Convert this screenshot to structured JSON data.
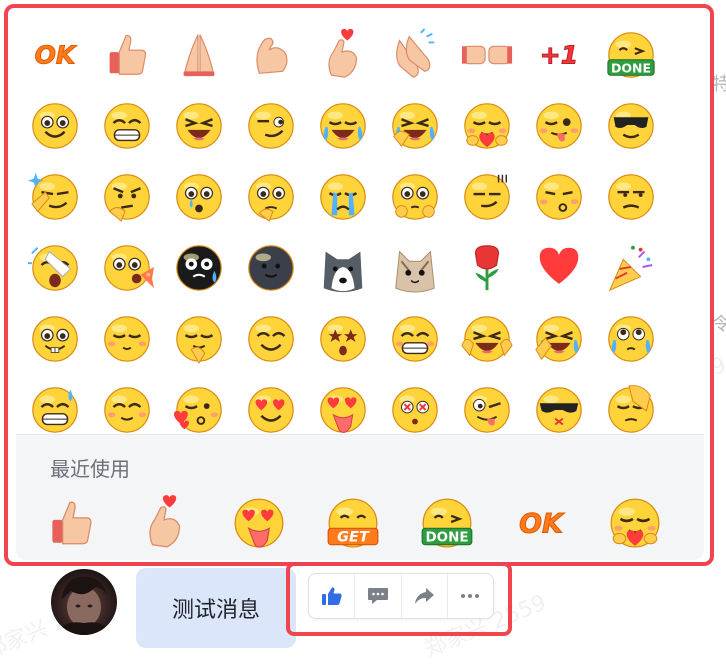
{
  "watermark": "郑家兴 2559",
  "edge_chars": [
    "特",
    "令"
  ],
  "emoji_panel": {
    "grid": [
      "ok-text",
      "thumbs-up",
      "praying-hands",
      "flexed-biceps",
      "finger-heart",
      "clapping-hands",
      "fist-bump",
      "plus-one",
      "done-face",
      "smile",
      "grin",
      "laugh",
      "smirk",
      "tears-of-joy",
      "rolling-laugh",
      "heart-hug",
      "tongue-wink",
      "sunglasses",
      "salute-smirk",
      "thinking",
      "tearful-shock",
      "thinking-eyes",
      "crying",
      "pleading",
      "cool-smirk",
      "kiss-blush",
      "unamused",
      "screaming-slipper",
      "spitting",
      "black-blob-shock",
      "dark-blob",
      "husky",
      "cat-face",
      "rose",
      "red-heart",
      "party-popper",
      "sponge-face",
      "blush",
      "giggle",
      "content-smile",
      "starstruck",
      "wide-grin",
      "laughing-hands",
      "laughing-tears",
      "pleading-tears",
      "sweat-grin",
      "happy-grin",
      "blowing-kiss",
      "heart-eyes",
      "drooling-tongue",
      "dizzy",
      "crazy-face",
      "sunglasses-x",
      "facepalm"
    ],
    "recent_label": "最近使用",
    "recent": [
      "thumbs-up",
      "finger-heart",
      "drooling-tongue",
      "get-face",
      "done-face",
      "ok-text",
      "heart-hug"
    ]
  },
  "message": {
    "text": "测试消息"
  },
  "toolbar": {
    "items": [
      "like-icon",
      "reply-icon",
      "forward-icon",
      "more-icon"
    ]
  },
  "colors": {
    "highlight": "#f0454f",
    "bubble": "#dbe6fb",
    "accent": "#2f6ee5",
    "emoji_yellow": "#ffd43b"
  },
  "labels": {
    "ok": "OK",
    "plus_one": "+1",
    "done": "DONE",
    "get": "GET"
  }
}
